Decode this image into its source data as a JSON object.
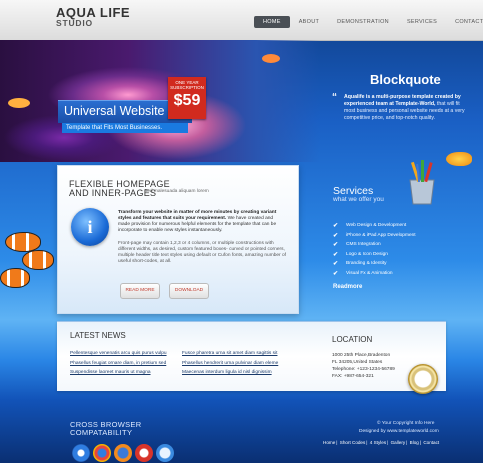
{
  "header": {
    "logo_line1": "AQUA LIFE",
    "logo_line2": "STUDIO",
    "nav": [
      "HOME",
      "ABOUT",
      "DEMONSTRATION",
      "SERVICES",
      "CONTACT"
    ],
    "active_nav": "HOME"
  },
  "hero": {
    "title": "Universal Website",
    "subtitle": "Template that Fits Most Businesses.",
    "price_note": "ONE YEAR SUBSCRIPTION",
    "price": "$59",
    "blockquote_title": "Blockquote",
    "blockquote_strong": "Aqualife is a multi-purpose template created by experienced team at Template-World,",
    "blockquote_rest": " that will fit most business and personal website needs at a very competitive price, and top-notch quality."
  },
  "feature": {
    "heading_line1": "FLEXIBLE HOMEPAGE",
    "heading_line2": "AND INNER-PAGES",
    "tagline": "Sed malesuada aliquam lorem",
    "para1_strong": "Transform your website in matter of more minutes by creating variant styles and features that suits your requirement.",
    "para1_rest": " We have created and made provision for numerous helpful elements for the template that can be incorporate to enable new styles instantaneously.",
    "para2": "Front-page may contain 1,2,3 or 4 columns, or multiple constructions with different widths, as desired, custom featured boxes- curved or pointed corners, multiple header title text styles using default or Cufon fonts, amazing number of useful short-codes, at all.",
    "read_more": "READ MORE",
    "download": "DOWNLOAD"
  },
  "services": {
    "title": "Services",
    "subtitle": "what we offer you",
    "items": [
      "Web Design & Development",
      "iPhone & iPad App Development",
      "CMS Integration",
      "Logo & Icon Design",
      "Branding & Identity",
      "Visual Fx & Animation"
    ],
    "readmore": "Readmore"
  },
  "news": {
    "title": "LATEST NEWS",
    "col1": [
      "Pellentesque venenatis arcu quis purus vulpu",
      "Phasellus feugiat ornare diam, in pretium sed",
      "Suspendisse laoreet mauris ut magna"
    ],
    "col2": [
      "Fusce pharetra urna sit amet diam sagittis sit",
      "Phasellus hendrerit urna pulvinar diam eleme",
      "Maecenas interdum ligula id nisl dignissim"
    ]
  },
  "location": {
    "title": "LOCATION",
    "line1": "1000 25th Place,Bradenton",
    "line2": "FL 34205,United States",
    "line3": "Telephone: +123-1234-56789",
    "line4": "FAX: +987-654-321"
  },
  "footer": {
    "cross_line1": "CROSS BROWSER",
    "cross_line2": "COMPATABILITY",
    "copyright": "© Your Copyright Info Here",
    "designed_by": "Designed by www.templateworld.com",
    "links": [
      "Home",
      "Short Codes",
      "4 Styles",
      "Gallery",
      "Blog",
      "Contact"
    ]
  },
  "colors": {
    "accent_red": "#d12a1e",
    "brand_blue": "#1a6ad6",
    "nav_active": "#4a4f55"
  }
}
